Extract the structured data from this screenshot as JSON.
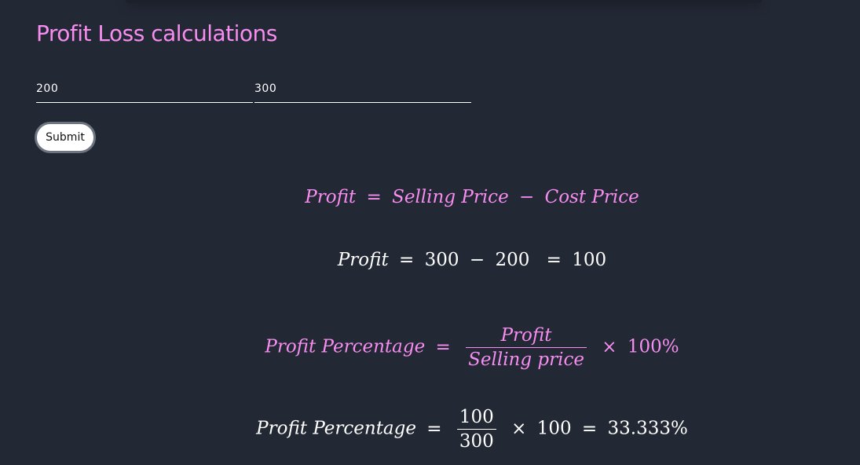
{
  "page": {
    "title": "Profit Loss calculations"
  },
  "form": {
    "cost_price_value": "200",
    "selling_price_value": "300",
    "submit_label": "Submit"
  },
  "formulas": {
    "profit_formula": {
      "lhs": "Profit",
      "op_eq": "=",
      "term1": "Selling Price",
      "op_minus": "−",
      "term2": "Cost Price"
    },
    "profit_calc": {
      "lhs": "Profit",
      "op_eq": "=",
      "selling": "300",
      "op_minus": "−",
      "cost": "200",
      "op_eq2": "=",
      "result": "100"
    },
    "percentage_formula": {
      "lhs": "Profit Percentage",
      "op_eq": "=",
      "numerator": "Profit",
      "denominator": "Selling price",
      "op_times": "×",
      "multiplier": "100%"
    },
    "percentage_calc": {
      "lhs": "Profit Percentage",
      "op_eq": "=",
      "numerator": "100",
      "denominator": "300",
      "op_times": "×",
      "multiplier": "100",
      "op_eq2": "=",
      "result": "33.333%"
    }
  },
  "colors": {
    "background": "#232835",
    "accent_pink": "#f78df0",
    "text_white": "#ffffff"
  }
}
